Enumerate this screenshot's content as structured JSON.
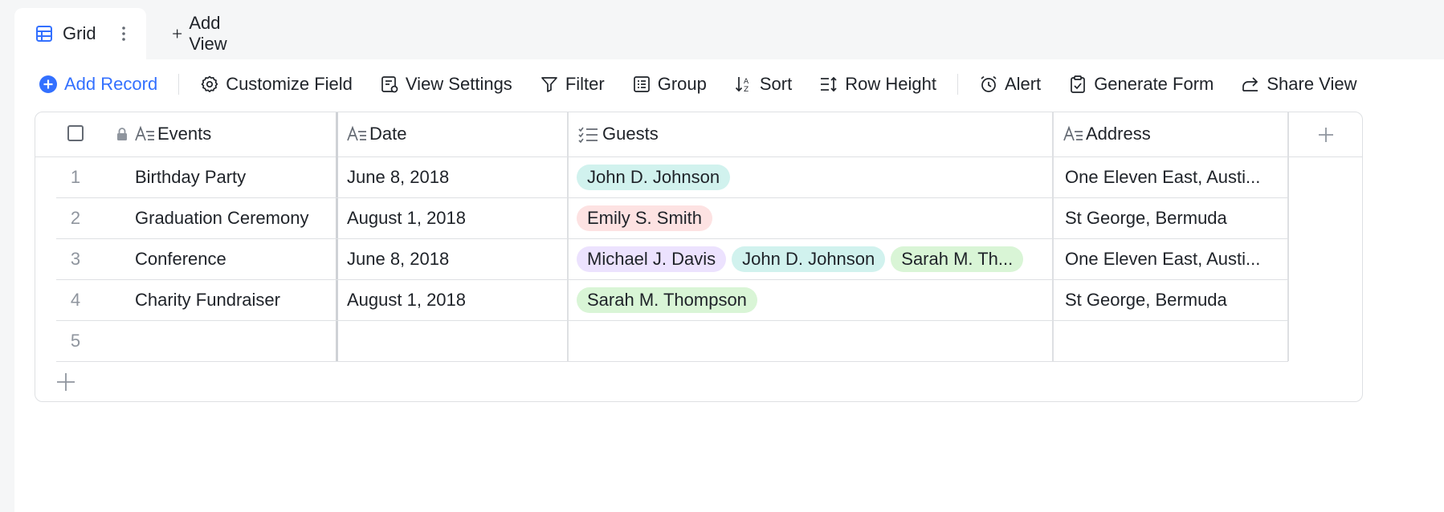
{
  "tabs": {
    "active_label": "Grid",
    "add_view_label": "Add View"
  },
  "toolbar": {
    "add_record": "Add Record",
    "customize_field": "Customize Field",
    "view_settings": "View Settings",
    "filter": "Filter",
    "group": "Group",
    "sort": "Sort",
    "row_height": "Row Height",
    "alert": "Alert",
    "generate_form": "Generate Form",
    "share_view": "Share View"
  },
  "colors": {
    "accent": "#3370ff",
    "chip_teal": "#d1f2ee",
    "chip_red": "#fde2e2",
    "chip_purple": "#ece2fe",
    "chip_green": "#d9f5d6"
  },
  "grid": {
    "columns": {
      "events": "Events",
      "date": "Date",
      "guests": "Guests",
      "address": "Address"
    },
    "rows": [
      {
        "num": "1",
        "event": "Birthday Party",
        "date": "June 8, 2018",
        "guests": [
          {
            "name": "John D. Johnson",
            "color": "#d1f2ee"
          }
        ],
        "address": "One Eleven East, Austi..."
      },
      {
        "num": "2",
        "event": "Graduation Ceremony",
        "date": "August 1, 2018",
        "guests": [
          {
            "name": "Emily S. Smith",
            "color": "#fde2e2"
          }
        ],
        "address": "St George, Bermuda"
      },
      {
        "num": "3",
        "event": "Conference",
        "date": "June 8, 2018",
        "guests": [
          {
            "name": "Michael J. Davis",
            "color": "#ece2fe"
          },
          {
            "name": "John D. Johnson",
            "color": "#d1f2ee"
          },
          {
            "name": "Sarah M. Th...",
            "color": "#d9f5d6"
          }
        ],
        "address": "One Eleven East, Austi..."
      },
      {
        "num": "4",
        "event": "Charity Fundraiser",
        "date": "August 1, 2018",
        "guests": [
          {
            "name": "Sarah M. Thompson",
            "color": "#d9f5d6"
          }
        ],
        "address": "St George, Bermuda"
      },
      {
        "num": "5",
        "event": "",
        "date": "",
        "guests": [],
        "address": ""
      }
    ]
  }
}
